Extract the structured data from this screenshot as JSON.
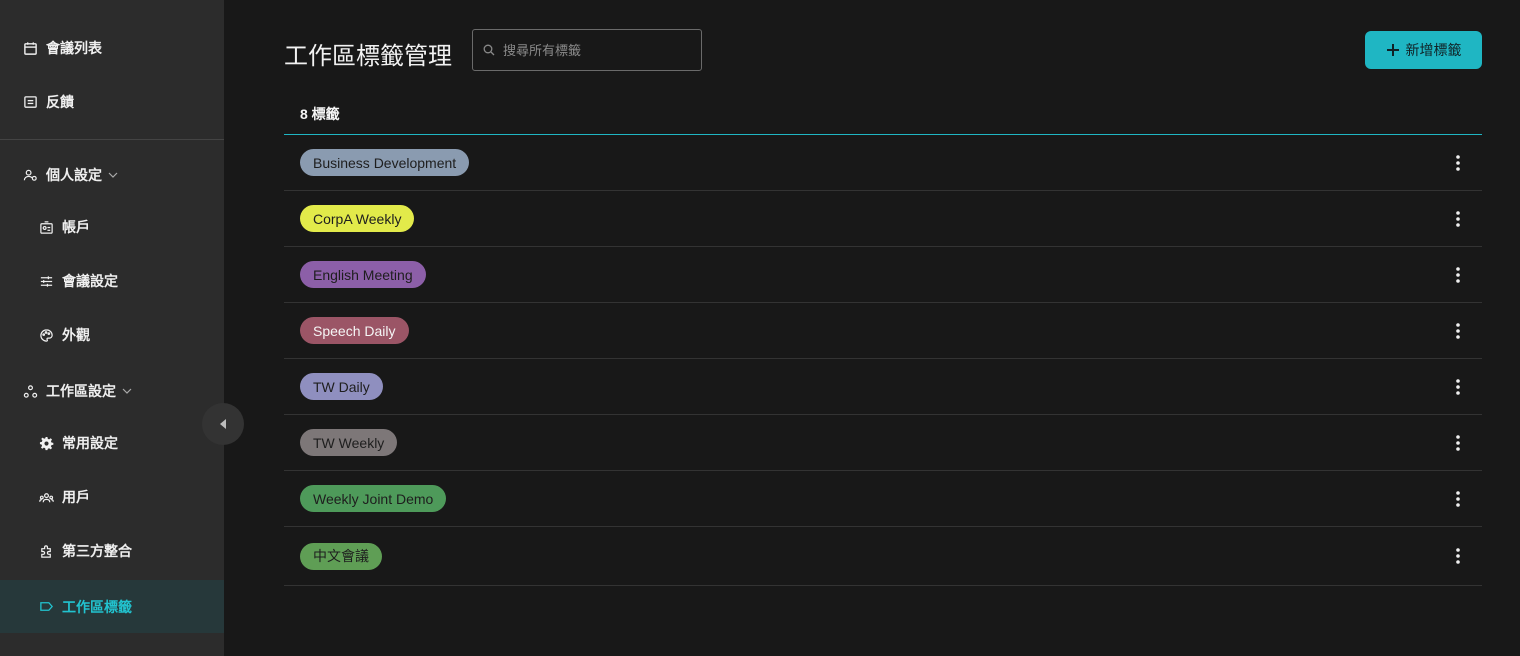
{
  "sidebar": {
    "items": [
      {
        "label": "會議列表"
      },
      {
        "label": "反饋"
      },
      {
        "label": "個人設定"
      },
      {
        "label": "帳戶"
      },
      {
        "label": "會議設定"
      },
      {
        "label": "外觀"
      },
      {
        "label": "工作區設定"
      },
      {
        "label": "常用設定"
      },
      {
        "label": "用戶"
      },
      {
        "label": "第三方整合"
      },
      {
        "label": "工作區標籤"
      }
    ],
    "active": "工作區標籤"
  },
  "header": {
    "title": "工作區標籤管理",
    "search_placeholder": "搜尋所有標籤",
    "add_label": "新增標籤"
  },
  "list": {
    "count_label": "8 標籤",
    "tags": [
      {
        "name": "Business Development",
        "color": "#8a9bb0"
      },
      {
        "name": "CorpA Weekly",
        "color": "#e2ea4a"
      },
      {
        "name": "English Meeting",
        "color": "#8c5fa8"
      },
      {
        "name": "Speech Daily",
        "color": "#9b5566"
      },
      {
        "name": "TW Daily",
        "color": "#8f8fbf"
      },
      {
        "name": "TW Weekly",
        "color": "#7d7778"
      },
      {
        "name": "Weekly Joint Demo",
        "color": "#4e9a5a"
      },
      {
        "name": "中文會議",
        "color": "#5f9e55"
      }
    ]
  },
  "colors": {
    "accent": "#1fb6c3",
    "sidebar_bg": "#2c2c2c",
    "page_bg": "#181818"
  }
}
